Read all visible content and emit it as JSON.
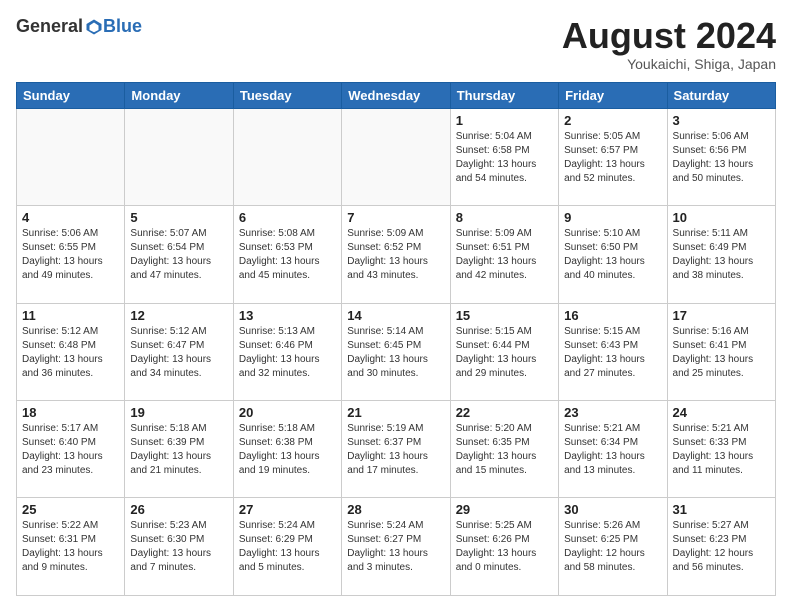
{
  "logo": {
    "general": "General",
    "blue": "Blue"
  },
  "title": {
    "month": "August 2024",
    "location": "Youkaichi, Shiga, Japan"
  },
  "days_of_week": [
    "Sunday",
    "Monday",
    "Tuesday",
    "Wednesday",
    "Thursday",
    "Friday",
    "Saturday"
  ],
  "weeks": [
    [
      {
        "day": "",
        "info": ""
      },
      {
        "day": "",
        "info": ""
      },
      {
        "day": "",
        "info": ""
      },
      {
        "day": "",
        "info": ""
      },
      {
        "day": "1",
        "info": "Sunrise: 5:04 AM\nSunset: 6:58 PM\nDaylight: 13 hours\nand 54 minutes."
      },
      {
        "day": "2",
        "info": "Sunrise: 5:05 AM\nSunset: 6:57 PM\nDaylight: 13 hours\nand 52 minutes."
      },
      {
        "day": "3",
        "info": "Sunrise: 5:06 AM\nSunset: 6:56 PM\nDaylight: 13 hours\nand 50 minutes."
      }
    ],
    [
      {
        "day": "4",
        "info": "Sunrise: 5:06 AM\nSunset: 6:55 PM\nDaylight: 13 hours\nand 49 minutes."
      },
      {
        "day": "5",
        "info": "Sunrise: 5:07 AM\nSunset: 6:54 PM\nDaylight: 13 hours\nand 47 minutes."
      },
      {
        "day": "6",
        "info": "Sunrise: 5:08 AM\nSunset: 6:53 PM\nDaylight: 13 hours\nand 45 minutes."
      },
      {
        "day": "7",
        "info": "Sunrise: 5:09 AM\nSunset: 6:52 PM\nDaylight: 13 hours\nand 43 minutes."
      },
      {
        "day": "8",
        "info": "Sunrise: 5:09 AM\nSunset: 6:51 PM\nDaylight: 13 hours\nand 42 minutes."
      },
      {
        "day": "9",
        "info": "Sunrise: 5:10 AM\nSunset: 6:50 PM\nDaylight: 13 hours\nand 40 minutes."
      },
      {
        "day": "10",
        "info": "Sunrise: 5:11 AM\nSunset: 6:49 PM\nDaylight: 13 hours\nand 38 minutes."
      }
    ],
    [
      {
        "day": "11",
        "info": "Sunrise: 5:12 AM\nSunset: 6:48 PM\nDaylight: 13 hours\nand 36 minutes."
      },
      {
        "day": "12",
        "info": "Sunrise: 5:12 AM\nSunset: 6:47 PM\nDaylight: 13 hours\nand 34 minutes."
      },
      {
        "day": "13",
        "info": "Sunrise: 5:13 AM\nSunset: 6:46 PM\nDaylight: 13 hours\nand 32 minutes."
      },
      {
        "day": "14",
        "info": "Sunrise: 5:14 AM\nSunset: 6:45 PM\nDaylight: 13 hours\nand 30 minutes."
      },
      {
        "day": "15",
        "info": "Sunrise: 5:15 AM\nSunset: 6:44 PM\nDaylight: 13 hours\nand 29 minutes."
      },
      {
        "day": "16",
        "info": "Sunrise: 5:15 AM\nSunset: 6:43 PM\nDaylight: 13 hours\nand 27 minutes."
      },
      {
        "day": "17",
        "info": "Sunrise: 5:16 AM\nSunset: 6:41 PM\nDaylight: 13 hours\nand 25 minutes."
      }
    ],
    [
      {
        "day": "18",
        "info": "Sunrise: 5:17 AM\nSunset: 6:40 PM\nDaylight: 13 hours\nand 23 minutes."
      },
      {
        "day": "19",
        "info": "Sunrise: 5:18 AM\nSunset: 6:39 PM\nDaylight: 13 hours\nand 21 minutes."
      },
      {
        "day": "20",
        "info": "Sunrise: 5:18 AM\nSunset: 6:38 PM\nDaylight: 13 hours\nand 19 minutes."
      },
      {
        "day": "21",
        "info": "Sunrise: 5:19 AM\nSunset: 6:37 PM\nDaylight: 13 hours\nand 17 minutes."
      },
      {
        "day": "22",
        "info": "Sunrise: 5:20 AM\nSunset: 6:35 PM\nDaylight: 13 hours\nand 15 minutes."
      },
      {
        "day": "23",
        "info": "Sunrise: 5:21 AM\nSunset: 6:34 PM\nDaylight: 13 hours\nand 13 minutes."
      },
      {
        "day": "24",
        "info": "Sunrise: 5:21 AM\nSunset: 6:33 PM\nDaylight: 13 hours\nand 11 minutes."
      }
    ],
    [
      {
        "day": "25",
        "info": "Sunrise: 5:22 AM\nSunset: 6:31 PM\nDaylight: 13 hours\nand 9 minutes."
      },
      {
        "day": "26",
        "info": "Sunrise: 5:23 AM\nSunset: 6:30 PM\nDaylight: 13 hours\nand 7 minutes."
      },
      {
        "day": "27",
        "info": "Sunrise: 5:24 AM\nSunset: 6:29 PM\nDaylight: 13 hours\nand 5 minutes."
      },
      {
        "day": "28",
        "info": "Sunrise: 5:24 AM\nSunset: 6:27 PM\nDaylight: 13 hours\nand 3 minutes."
      },
      {
        "day": "29",
        "info": "Sunrise: 5:25 AM\nSunset: 6:26 PM\nDaylight: 13 hours\nand 0 minutes."
      },
      {
        "day": "30",
        "info": "Sunrise: 5:26 AM\nSunset: 6:25 PM\nDaylight: 12 hours\nand 58 minutes."
      },
      {
        "day": "31",
        "info": "Sunrise: 5:27 AM\nSunset: 6:23 PM\nDaylight: 12 hours\nand 56 minutes."
      }
    ]
  ]
}
